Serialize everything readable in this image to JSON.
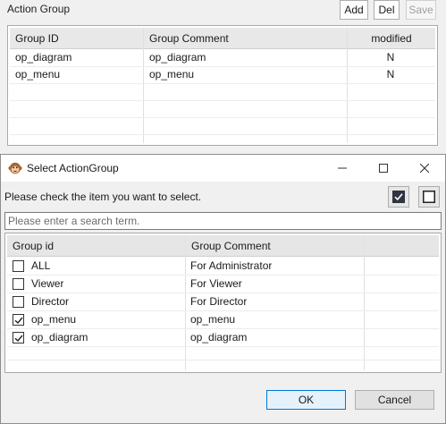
{
  "panel": {
    "title": "Action Group",
    "buttons": {
      "add": "Add",
      "del": "Del",
      "save": "Save"
    },
    "table": {
      "headers": [
        "Group ID",
        "Group Comment",
        "modified"
      ],
      "rows": [
        [
          "op_diagram",
          "op_diagram",
          "N"
        ],
        [
          "op_menu",
          "op_menu",
          "N"
        ]
      ]
    }
  },
  "dialog": {
    "title": "Select ActionGroup",
    "instruction": "Please check the item you want to select.",
    "search_placeholder": "Please enter a search term.",
    "table": {
      "headers": [
        "Group id",
        "Group Comment",
        ""
      ],
      "rows": [
        {
          "id": "ALL",
          "comment": "For Administrator",
          "checked": false
        },
        {
          "id": "Viewer",
          "comment": "For Viewer",
          "checked": false
        },
        {
          "id": "Director",
          "comment": "For Director",
          "checked": false
        },
        {
          "id": "op_menu",
          "comment": "op_menu",
          "checked": true
        },
        {
          "id": "op_diagram",
          "comment": "op_diagram",
          "checked": true
        }
      ]
    },
    "ok_label": "OK",
    "cancel_label": "Cancel"
  },
  "icons": {
    "app": "monkey-app-icon",
    "minimize": "minimize-icon",
    "maximize": "maximize-icon",
    "close": "close-icon",
    "check_all": "check-all-icon",
    "uncheck_all": "uncheck-all-icon",
    "checkmark": "checkmark-icon"
  },
  "colors": {
    "accent": "#0078d7",
    "header_bg": "#e8e8e8",
    "dialog_bg": "#f0f0f0"
  }
}
